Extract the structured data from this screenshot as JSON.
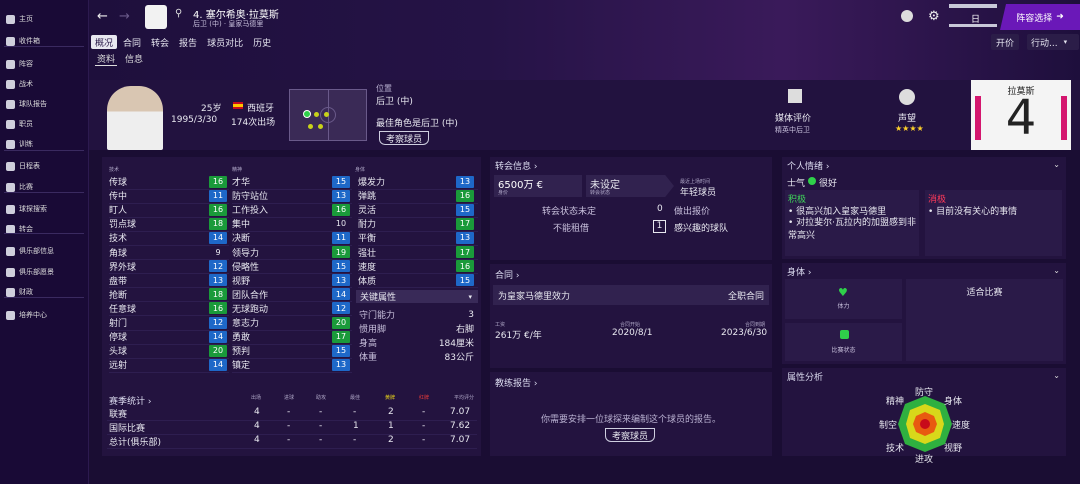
{
  "sidebar": [
    {
      "label": "主页",
      "icon": "home-icon"
    },
    {
      "label": "收件箱",
      "icon": "inbox-icon"
    },
    {
      "label": "阵容",
      "icon": "shirt-icon"
    },
    {
      "label": "战术",
      "icon": "tactics-icon"
    },
    {
      "label": "球队报告",
      "icon": "report-icon"
    },
    {
      "label": "职员",
      "icon": "staff-icon"
    },
    {
      "label": "训练",
      "icon": "training-icon"
    },
    {
      "label": "日程表",
      "icon": "calendar-icon"
    },
    {
      "label": "比赛",
      "icon": "trophy-icon"
    },
    {
      "label": "球探搜索",
      "icon": "scout-icon"
    },
    {
      "label": "转会",
      "icon": "transfer-icon"
    },
    {
      "label": "俱乐部信息",
      "icon": "club-info-icon"
    },
    {
      "label": "俱乐部愿景",
      "icon": "vision-icon"
    },
    {
      "label": "财政",
      "icon": "finance-icon"
    },
    {
      "label": "培养中心",
      "icon": "development-icon"
    }
  ],
  "header": {
    "player_name": "4. 塞尔希奥·拉莫斯",
    "player_sub": "后卫 (中) · 皇家马德里",
    "squad_select": "阵容选择",
    "date_suffix": "日",
    "btn_renew": "开价",
    "btn_action": "行动...",
    "tabs": [
      "概况",
      "合同",
      "转会",
      "报告",
      "球员对比",
      "历史"
    ],
    "subtabs": [
      "资料",
      "信息"
    ]
  },
  "profile": {
    "age": "25岁",
    "nation": "西班牙",
    "dob": "1995/3/30",
    "apps": "174次出场",
    "position_label": "位置",
    "position": "后卫 (中)",
    "best_role": "最佳角色是后卫 (中)",
    "scout_btn": "考察球员",
    "media_label": "媒体评价",
    "media_value": "精英中后卫",
    "reputation_label": "声望",
    "reputation_stars": "★★★★",
    "shirt_name": "拉莫斯",
    "shirt_number": "4"
  },
  "attributes": {
    "tech_header": "技术",
    "mental_header": "精神",
    "physical_header": "身体",
    "technical": [
      {
        "name": "传球",
        "v": 16
      },
      {
        "name": "传中",
        "v": 11
      },
      {
        "name": "盯人",
        "v": 16
      },
      {
        "name": "罚点球",
        "v": 18
      },
      {
        "name": "技术",
        "v": 14
      },
      {
        "name": "角球",
        "v": 9
      },
      {
        "name": "界外球",
        "v": 12
      },
      {
        "name": "盘带",
        "v": 13
      },
      {
        "name": "抢断",
        "v": 18
      },
      {
        "name": "任意球",
        "v": 16
      },
      {
        "name": "射门",
        "v": 12
      },
      {
        "name": "停球",
        "v": 14
      },
      {
        "name": "头球",
        "v": 20
      },
      {
        "name": "远射",
        "v": 14
      }
    ],
    "mental": [
      {
        "name": "才华",
        "v": 15
      },
      {
        "name": "防守站位",
        "v": 13
      },
      {
        "name": "工作投入",
        "v": 16
      },
      {
        "name": "集中",
        "v": 10
      },
      {
        "name": "决断",
        "v": 11
      },
      {
        "name": "领导力",
        "v": 19
      },
      {
        "name": "侵略性",
        "v": 15
      },
      {
        "name": "视野",
        "v": 13
      },
      {
        "name": "团队合作",
        "v": 14
      },
      {
        "name": "无球跑动",
        "v": 12
      },
      {
        "name": "意志力",
        "v": 20
      },
      {
        "name": "勇敢",
        "v": 17
      },
      {
        "name": "预判",
        "v": 15
      },
      {
        "name": "镇定",
        "v": 13
      }
    ],
    "physical": [
      {
        "name": "爆发力",
        "v": 13
      },
      {
        "name": "弹跳",
        "v": 16
      },
      {
        "name": "灵活",
        "v": 15
      },
      {
        "name": "耐力",
        "v": 17
      },
      {
        "name": "平衡",
        "v": 13
      },
      {
        "name": "强壮",
        "v": 17
      },
      {
        "name": "速度",
        "v": 16
      },
      {
        "name": "体质",
        "v": 15
      }
    ],
    "key_attr_label": "关键属性",
    "extra": [
      {
        "name": "守门能力",
        "v": "3"
      },
      {
        "name": "惯用脚",
        "v": "右脚"
      },
      {
        "name": "身高",
        "v": "184厘米"
      },
      {
        "name": "体重",
        "v": "83公斤"
      }
    ]
  },
  "season_stats": {
    "title": "赛季统计",
    "headers": [
      "出场",
      "进球",
      "助攻",
      "最佳",
      "黄牌",
      "红牌",
      "平均评分"
    ],
    "rows": [
      {
        "name": "联赛",
        "vals": [
          "4",
          "-",
          "-",
          "-",
          "2",
          "-",
          "7.07"
        ]
      },
      {
        "name": "国际比赛",
        "vals": [
          "4",
          "-",
          "-",
          "1",
          "1",
          "-",
          "7.62"
        ]
      },
      {
        "name": "总计(俱乐部)",
        "vals": [
          "4",
          "-",
          "-",
          "-",
          "2",
          "-",
          "7.07"
        ]
      }
    ]
  },
  "transfer": {
    "title": "转会信息",
    "value": "6500万 €",
    "value_label": "身价",
    "status": "未设定",
    "status_label": "转会状态",
    "recent_label": "最近上场时间",
    "recent_value": "年轻球员",
    "state_label": "转会状态未定",
    "offers_count": "0",
    "offers_label": "做出报价",
    "loan_label": "不能租借",
    "interest_count": "1",
    "interest_label": "感兴趣的球队"
  },
  "contract": {
    "title": "合同",
    "club": "为皇家马德里效力",
    "type": "全职合同",
    "wage_label": "工资",
    "wage": "261万 €/年",
    "start_label": "合同开始",
    "start": "2020/8/1",
    "end_label": "合同到期",
    "end": "2023/6/30"
  },
  "coach_report": {
    "title": "教练报告",
    "text": "你需要安排一位球探来编制这个球员的报告。",
    "btn": "考察球员"
  },
  "personal": {
    "title": "个人情绪",
    "morale_label": "士气",
    "morale_value": "很好",
    "positive_label": "积极",
    "positives": [
      "很高兴加入皇家马德里",
      "对拉斐尔·瓦拉内的加盟感到非常高兴"
    ],
    "negative_label": "消极",
    "negatives": [
      "目前没有关心的事情"
    ]
  },
  "body": {
    "title": "身体",
    "fitness_label": "体力",
    "condition_label": "比赛状态",
    "status": "适合比赛"
  },
  "attr_analysis": {
    "title": "属性分析",
    "labels": [
      "防守",
      "身体",
      "速度",
      "视野",
      "进攻",
      "技术",
      "制空",
      "精神"
    ]
  }
}
